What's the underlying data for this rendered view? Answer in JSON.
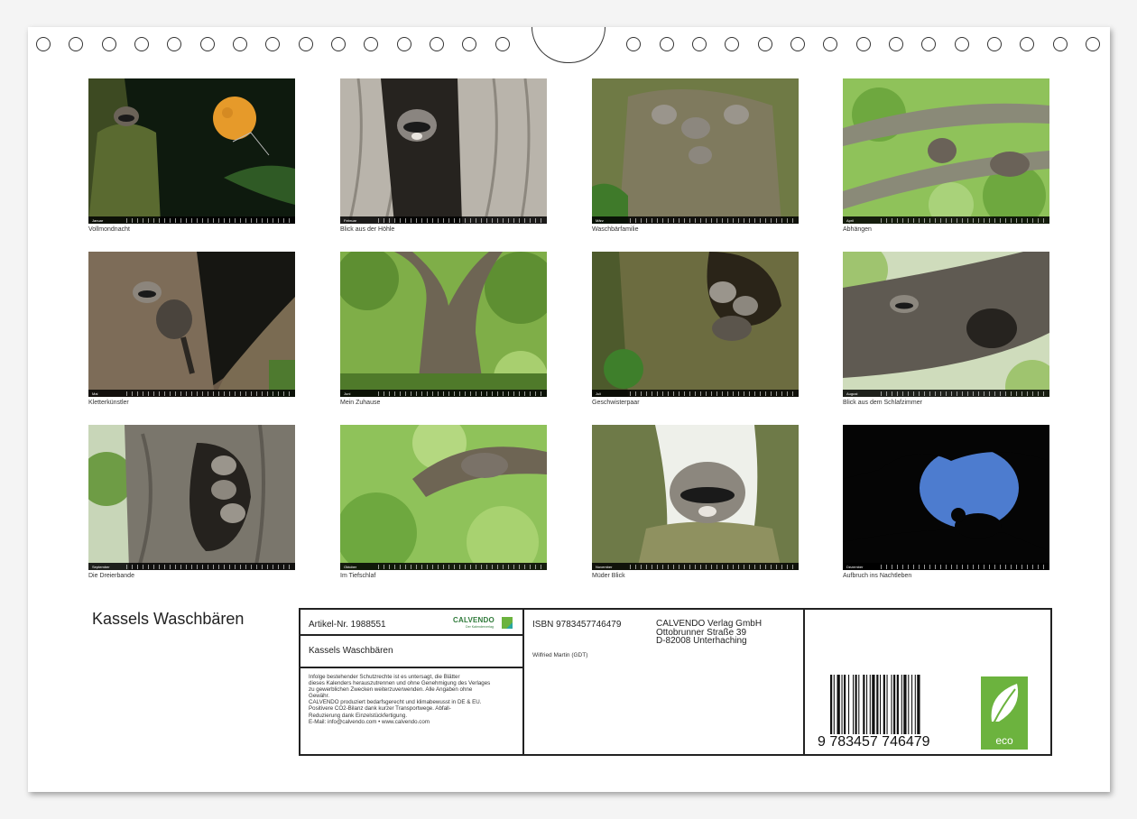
{
  "calendar": {
    "title": "Kassels Waschbären",
    "months": [
      {
        "month": "Januar",
        "caption": "Vollmondnacht"
      },
      {
        "month": "Februar",
        "caption": "Blick aus der Höhle"
      },
      {
        "month": "März",
        "caption": "Waschbärfamilie"
      },
      {
        "month": "April",
        "caption": "Abhängen"
      },
      {
        "month": "Mai",
        "caption": "Kletterkünstler"
      },
      {
        "month": "Juni",
        "caption": "Mein Zuhause"
      },
      {
        "month": "Juli",
        "caption": "Geschwisterpaar"
      },
      {
        "month": "August",
        "caption": "Blick aus dem Schlafzimmer"
      },
      {
        "month": "September",
        "caption": "Die Dreierbande"
      },
      {
        "month": "Oktober",
        "caption": "Im Tiefschlaf"
      },
      {
        "month": "November",
        "caption": "Müder Blick"
      },
      {
        "month": "Dezember",
        "caption": "Aufbruch ins Nachtleben"
      }
    ]
  },
  "info": {
    "artikel": "Artikel-Nr. 1988551",
    "logo_name": "CALVENDO",
    "logo_tagline": "Der Kalenderverlag",
    "subtitle": "Kassels Waschbären",
    "legal_lines": [
      "Infolge bestehender Schutzrechte ist es untersagt, die Blätter",
      "dieses Kalenders herauszutrennen und ohne Genehmigung des Verlages",
      "zu gewerblichen Zwecken weiterzuverwenden. Alle Angaben ohne",
      "Gewähr.",
      "CALVENDO produziert bedarfsgerecht und klimabewusst in DE & EU.",
      "Positivere CO2-Bilanz dank kurzer Transportwege. Abfall-",
      "Reduzierung dank Einzelstückfertigung.",
      "E-Mail: info@calvendo.com • www.calvendo.com"
    ],
    "isbn": "ISBN 9783457746479",
    "author": "Wilfried Martin (GDT)",
    "publisher_lines": [
      "CALVENDO Verlag GmbH",
      "Ottobrunner Straße 39",
      "D-82008 Unterhaching"
    ],
    "barcode_digits": "9 783457 746479",
    "eco_label": "eco"
  },
  "colors": {
    "frame": "#222222",
    "eco_green": "#6cb33e",
    "logo_green": "#2f7a3a"
  }
}
